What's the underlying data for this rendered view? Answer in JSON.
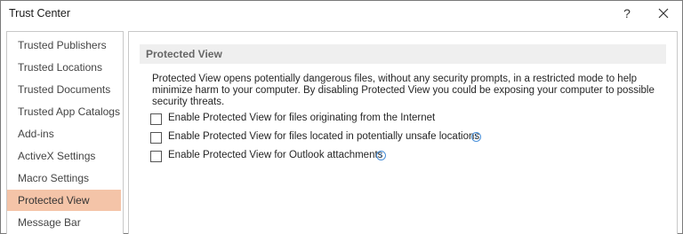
{
  "window": {
    "title": "Trust Center",
    "help_label": "?",
    "close_icon": "close-icon"
  },
  "sidebar": {
    "items": [
      {
        "label": "Trusted Publishers",
        "selected": false
      },
      {
        "label": "Trusted Locations",
        "selected": false
      },
      {
        "label": "Trusted Documents",
        "selected": false
      },
      {
        "label": "Trusted App Catalogs",
        "selected": false
      },
      {
        "label": "Add-ins",
        "selected": false
      },
      {
        "label": "ActiveX Settings",
        "selected": false
      },
      {
        "label": "Macro Settings",
        "selected": false
      },
      {
        "label": "Protected View",
        "selected": true
      },
      {
        "label": "Message Bar",
        "selected": false
      }
    ]
  },
  "main": {
    "section_title": "Protected View",
    "description": "Protected View opens potentially dangerous files, without any security prompts, in a restricted mode to help minimize harm to your computer. By disabling Protected View you could be exposing your computer to possible security threats.",
    "options": [
      {
        "label": "Enable Protected View for files originating from the Internet",
        "checked": false,
        "info_icon": false
      },
      {
        "label": "Enable Protected View for files located in potentially unsafe locations",
        "checked": false,
        "info_icon": true
      },
      {
        "label": "Enable Protected View for Outlook attachments",
        "checked": false,
        "info_icon": true
      }
    ],
    "info_glyph": "i"
  },
  "colors": {
    "selected_nav": "#f4c4a8",
    "section_header_bg": "#efefef",
    "info_icon": "#4a90d9"
  }
}
